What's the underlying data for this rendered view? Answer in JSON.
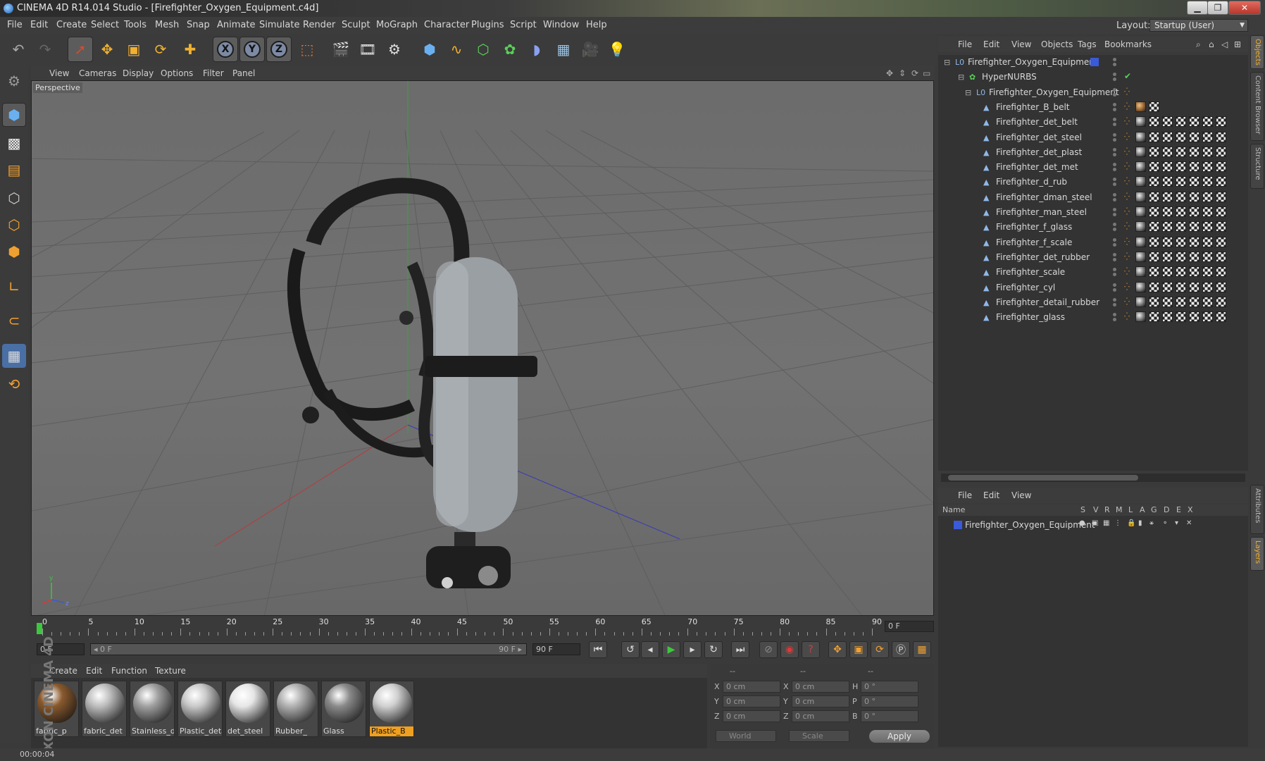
{
  "window": {
    "title": "CINEMA 4D R14.014 Studio - [Firefighter_Oxygen_Equipment.c4d]",
    "minimize": "▁",
    "maximize": "❐",
    "close": "✕"
  },
  "menubar": {
    "items": [
      "File",
      "Edit",
      "Create",
      "Select",
      "Tools",
      "Mesh",
      "Snap",
      "Animate",
      "Simulate",
      "Render",
      "Sculpt",
      "MoGraph",
      "Character",
      "Plugins",
      "Script",
      "Window",
      "Help"
    ],
    "layout_label": "Layout:",
    "layout_value": "Startup (User)"
  },
  "viewport": {
    "menu": [
      "View",
      "Cameras",
      "Display",
      "Options",
      "Filter",
      "Panel"
    ],
    "label": "Perspective"
  },
  "timeline": {
    "ticks": [
      "0",
      "5",
      "10",
      "15",
      "20",
      "25",
      "30",
      "35",
      "40",
      "45",
      "50",
      "55",
      "60",
      "65",
      "70",
      "75",
      "80",
      "85",
      "90"
    ],
    "current_frame": "0 F",
    "start_field": "0 F",
    "range_start": "◂ 0 F",
    "range_end": "90 F ▸",
    "end_field": "90 F"
  },
  "materials": {
    "menu": [
      "Create",
      "Edit",
      "Function",
      "Texture"
    ],
    "items": [
      {
        "name": "fabric_p",
        "color": "#8a5a2e"
      },
      {
        "name": "fabric_det",
        "color": "#bdbdbd"
      },
      {
        "name": "Stainless_d",
        "color": "#a0a0a0"
      },
      {
        "name": "Plastic_deta",
        "color": "#c9c9c9"
      },
      {
        "name": "det_steel",
        "color": "#e6e6e6"
      },
      {
        "name": "Rubber_",
        "color": "#b0b0b0"
      },
      {
        "name": "Glass",
        "color": "#8a8a8a"
      },
      {
        "name": "Plastic_B",
        "color": "#d0d0d0"
      }
    ]
  },
  "coordinates": {
    "headers": [
      "--",
      "--",
      "--"
    ],
    "rows": [
      {
        "a1": "X",
        "v1": "0 cm",
        "a2": "X",
        "v2": "0 cm",
        "a3": "H",
        "v3": "0 °"
      },
      {
        "a1": "Y",
        "v1": "0 cm",
        "a2": "Y",
        "v2": "0 cm",
        "a3": "P",
        "v3": "0 °"
      },
      {
        "a1": "Z",
        "v1": "0 cm",
        "a2": "Z",
        "v2": "0 cm",
        "a3": "B",
        "v3": "0 °"
      }
    ],
    "mode1": "World",
    "mode2": "Scale",
    "apply": "Apply"
  },
  "status": {
    "time": "00:00:04"
  },
  "branding": "MAXON CINEMA 4D",
  "objects": {
    "menu": [
      "File",
      "Edit",
      "View",
      "Objects",
      "Tags",
      "Bookmarks"
    ],
    "items": [
      {
        "name": "Firefighter_Oxygen_Equipment",
        "icon": "L0"
      },
      {
        "name": "HyperNURBS",
        "icon": "✿"
      },
      {
        "name": "Firefighter_Oxygen_Equipment",
        "icon": "L0"
      },
      {
        "name": "Firefighter_B_belt",
        "icon": "▲"
      },
      {
        "name": "Firefighter_det_belt",
        "icon": "▲"
      },
      {
        "name": "Firefighter_det_steel",
        "icon": "▲"
      },
      {
        "name": "Firefighter_det_plast",
        "icon": "▲"
      },
      {
        "name": "Firefighter_det_met",
        "icon": "▲"
      },
      {
        "name": "Firefighter_d_rub",
        "icon": "▲"
      },
      {
        "name": "Firefighter_dman_steel",
        "icon": "▲"
      },
      {
        "name": "Firefighter_man_steel",
        "icon": "▲"
      },
      {
        "name": "Firefighter_f_glass",
        "icon": "▲"
      },
      {
        "name": "Firefighter_f_scale",
        "icon": "▲"
      },
      {
        "name": "Firefighter_det_rubber",
        "icon": "▲"
      },
      {
        "name": "Firefighter_scale",
        "icon": "▲"
      },
      {
        "name": "Firefighter_cyl",
        "icon": "▲"
      },
      {
        "name": "Firefighter_detail_rubber",
        "icon": "▲"
      },
      {
        "name": "Firefighter_glass",
        "icon": "▲"
      }
    ]
  },
  "layers": {
    "menu": [
      "File",
      "Edit",
      "View"
    ],
    "columns": [
      "Name",
      "S",
      "V",
      "R",
      "M",
      "L",
      "A",
      "G",
      "D",
      "E",
      "X"
    ],
    "rows": [
      {
        "name": "Firefighter_Oxygen_Equipment",
        "color": "#3a5ad8"
      }
    ]
  },
  "sidetabs": [
    "Objects",
    "Content Browser",
    "Structure",
    "Attributes",
    "Layers"
  ],
  "colors": {
    "accent": "#f0a020",
    "layer_blue": "#3a5ad8",
    "play_green": "#3cc83c",
    "record_red": "#d83a3a"
  }
}
